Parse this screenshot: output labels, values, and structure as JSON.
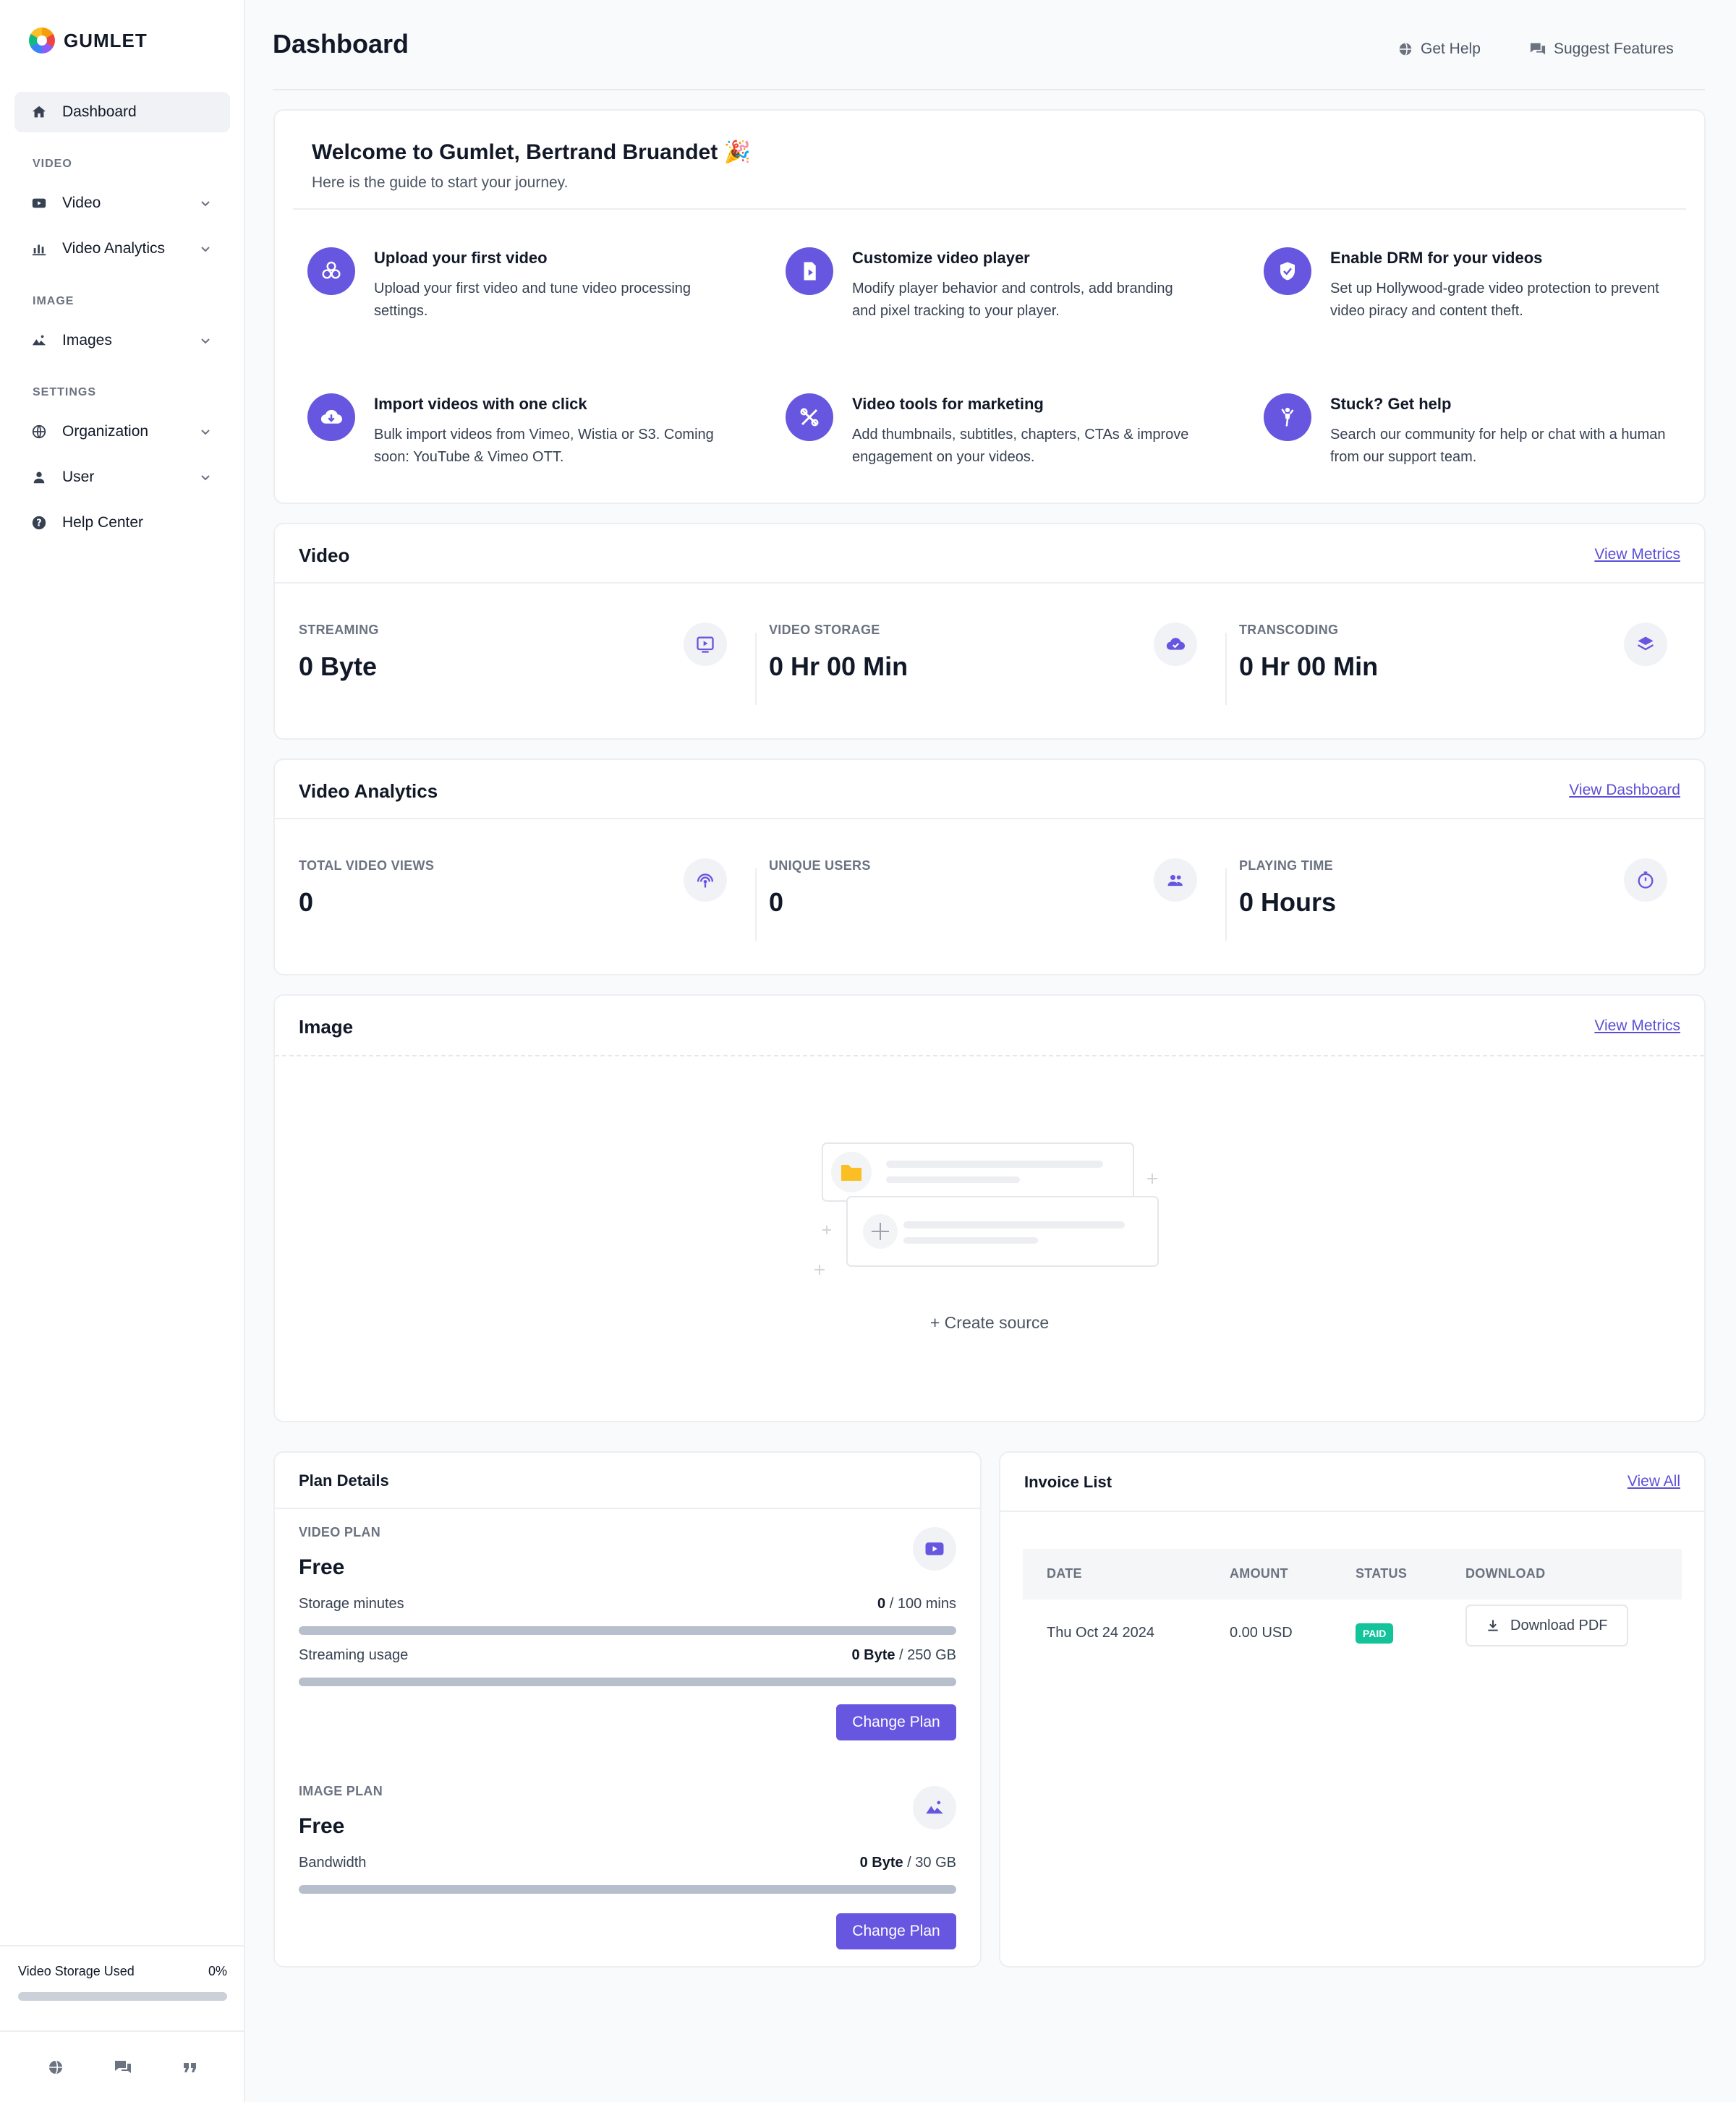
{
  "brand": {
    "name": "GUMLET"
  },
  "sidebar": {
    "dashboard": "Dashboard",
    "sections": {
      "video": "VIDEO",
      "image": "IMAGE",
      "settings": "SETTINGS"
    },
    "items": {
      "video": "Video",
      "video_analytics": "Video Analytics",
      "images": "Images",
      "organization": "Organization",
      "user": "User",
      "help_center": "Help Center"
    },
    "storage": {
      "label": "Video Storage Used",
      "value": "0%",
      "fraction": 0
    }
  },
  "header": {
    "title": "Dashboard",
    "get_help": "Get Help",
    "suggest_features": "Suggest Features"
  },
  "welcome": {
    "title": "Welcome to Gumlet, Bertrand Bruandet 🎉",
    "subtitle": "Here is the guide to start your journey.",
    "guides": [
      {
        "title": "Upload your first video",
        "desc": "Upload your first video and tune video processing settings.",
        "icon": "upload-icon"
      },
      {
        "title": "Customize video player",
        "desc": "Modify player behavior and controls, add branding and pixel tracking to your player.",
        "icon": "player-icon"
      },
      {
        "title": "Enable DRM for your videos",
        "desc": "Set up Hollywood-grade video protection to prevent video piracy and content theft.",
        "icon": "shield-icon"
      },
      {
        "title": "Import videos with one click",
        "desc": "Bulk import videos from Vimeo, Wistia or S3. Coming soon: YouTube & Vimeo OTT.",
        "icon": "cloud-download-icon"
      },
      {
        "title": "Video tools for marketing",
        "desc": "Add thumbnails, subtitles, chapters, CTAs & improve engagement on your videos.",
        "icon": "tools-icon"
      },
      {
        "title": "Stuck? Get help",
        "desc": "Search our community for help or chat with a human from our support team.",
        "icon": "hand-icon"
      }
    ]
  },
  "video_card": {
    "title": "Video",
    "link": "View Metrics",
    "metrics": [
      {
        "label": "STREAMING",
        "value": "0 Byte"
      },
      {
        "label": "VIDEO STORAGE",
        "value": "0 Hr 00 Min"
      },
      {
        "label": "TRANSCODING",
        "value": "0 Hr 00 Min"
      }
    ]
  },
  "analytics_card": {
    "title": "Video Analytics",
    "link": "View Dashboard",
    "metrics": [
      {
        "label": "TOTAL VIDEO VIEWS",
        "value": "0"
      },
      {
        "label": "UNIQUE USERS",
        "value": "0"
      },
      {
        "label": "PLAYING TIME",
        "value": "0 Hours"
      }
    ]
  },
  "image_card": {
    "title": "Image",
    "link": "View Metrics",
    "create_source": "+ Create source"
  },
  "plan": {
    "title": "Plan Details",
    "video_plan_label": "VIDEO PLAN",
    "video_plan_name": "Free",
    "storage_label": "Storage minutes",
    "storage_used": "0",
    "storage_total": " / 100 mins",
    "streaming_label": "Streaming usage",
    "streaming_used": "0 Byte",
    "streaming_total": " / 250 GB",
    "image_plan_label": "IMAGE PLAN",
    "image_plan_name": "Free",
    "bandwidth_label": "Bandwidth",
    "bandwidth_used": "0 Byte",
    "bandwidth_total": " / 30 GB",
    "change_plan": "Change Plan"
  },
  "invoices": {
    "title": "Invoice List",
    "view_all": "View All",
    "columns": [
      "DATE",
      "AMOUNT",
      "STATUS",
      "DOWNLOAD"
    ],
    "rows": [
      {
        "date": "Thu Oct 24 2024",
        "amount": "0.00 USD",
        "status": "PAID",
        "download": "Download PDF"
      }
    ]
  },
  "colors": {
    "accent": "#6656e0",
    "paid": "#13c39a",
    "folder": "#fbbf24"
  }
}
